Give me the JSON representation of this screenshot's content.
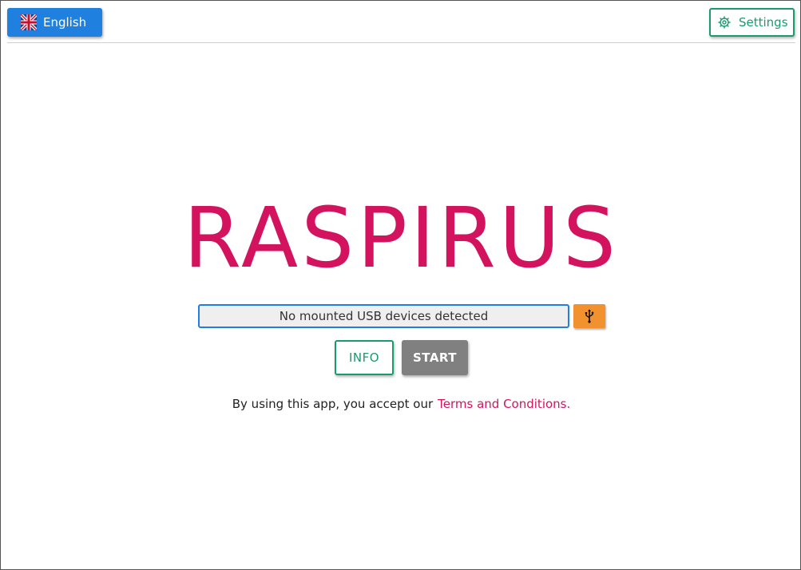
{
  "header": {
    "language_label": "English",
    "language_flag_icon": "uk-flag-icon",
    "settings_label": "Settings",
    "settings_icon": "gear-icon"
  },
  "main": {
    "title": "RASPIRUS",
    "usb_status": "No mounted USB devices detected",
    "usb_icon": "usb-icon",
    "info_label": "INFO",
    "start_label": "START",
    "terms_prefix": "By using this app, you accept our",
    "terms_link": "Terms and Conditions."
  },
  "colors": {
    "brand": "#d4135f",
    "primary_blue": "#1f80e0",
    "green": "#1c9a6d",
    "usb_orange": "#f2922f",
    "disabled_gray": "#808080"
  }
}
